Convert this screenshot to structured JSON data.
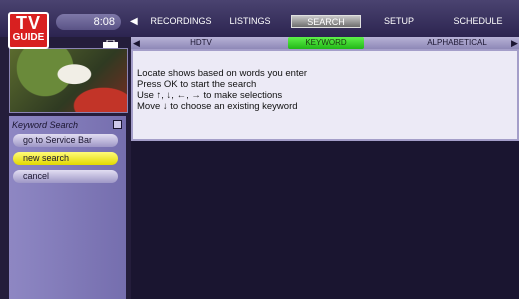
{
  "logo": {
    "top": "TV",
    "bottom": "GUIDE"
  },
  "clock": "8:08",
  "nav": {
    "items": [
      "RECORDINGS",
      "LISTINGS",
      "SEARCH",
      "SETUP",
      "SCHEDULE"
    ],
    "active": "SEARCH"
  },
  "tabs": {
    "items": [
      "HDTV",
      "KEYWORD",
      "ALPHABETICAL"
    ],
    "active": "KEYWORD"
  },
  "instructions": [
    "Locate shows based on words you enter",
    "Press OK to start the search",
    "Use ↑, ↓, ←, → to make selections",
    "Move ↓ to choose an existing keyword"
  ],
  "panel": {
    "title": "Keyword Search",
    "buttons": [
      "go to Service Bar",
      "new search",
      "cancel"
    ],
    "selected": "new search"
  },
  "colors": {
    "selected_button": "#f5ed2a",
    "active_tab": "#3ad82a",
    "logo_red": "#d82020"
  }
}
